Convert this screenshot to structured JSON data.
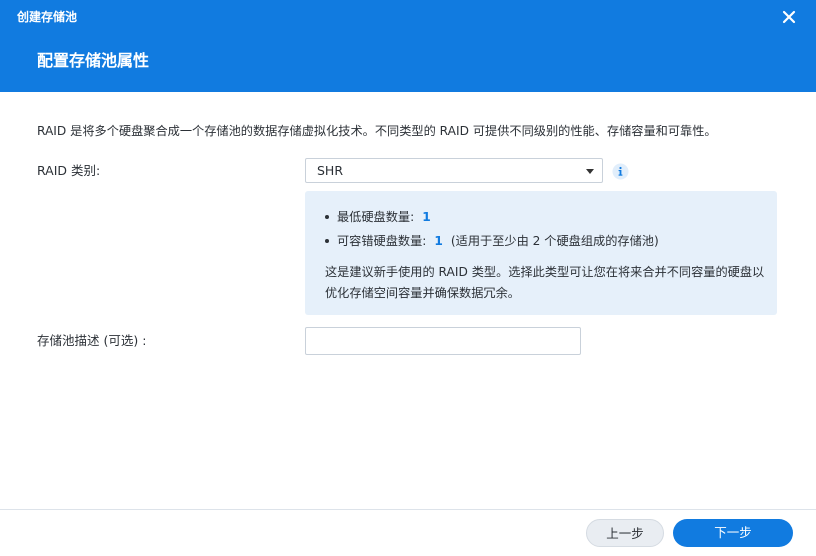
{
  "window": {
    "title": "创建存储池",
    "close_icon": "close-icon"
  },
  "step": {
    "title": "配置存储池属性"
  },
  "description": "RAID 是将多个硬盘聚合成一个存储池的数据存储虚拟化技术。不同类型的 RAID 可提供不同级别的性能、存储容量和可靠性。",
  "raid_type": {
    "label": "RAID 类别:",
    "selected": "SHR",
    "info_icon": "info-icon"
  },
  "info": {
    "min_disks_label": "最低硬盘数量:",
    "min_disks_value": "1",
    "fault_tolerance_label": "可容错硬盘数量:",
    "fault_tolerance_value": "1",
    "fault_tolerance_note": "(适用于至少由 2 个硬盘组成的存储池)",
    "paragraph": "这是建议新手使用的 RAID 类型。选择此类型可让您在将来合并不同容量的硬盘以优化存储空间容量并确保数据冗余。"
  },
  "pool_description": {
    "label": "存储池描述 (可选) :",
    "value": "",
    "placeholder": ""
  },
  "footer": {
    "prev_label": "上一步",
    "next_label": "下一步"
  },
  "colors": {
    "accent": "#117be0",
    "info_bg": "#e6f0fa"
  }
}
